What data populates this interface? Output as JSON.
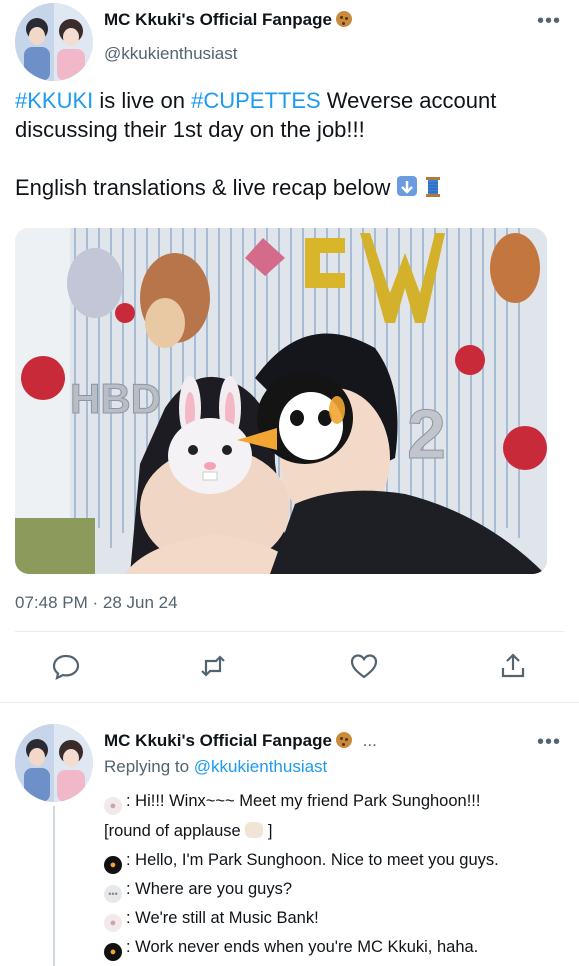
{
  "tweet": {
    "author_name": "MC Kkuki's Official Fanpage",
    "author_handle": "@kkukienthusiast",
    "more_label": "•••",
    "text": {
      "hashtag1": "#KKUKI",
      "part1": " is live on ",
      "hashtag2": "#CUPETTES",
      "part2": " Weverse account discussing their 1st day on the job!!!",
      "line2": "English translations & live recap below"
    },
    "timestamp": "07:48 PM · 28 Jun 24",
    "photo": {
      "balloon_letters": "HBD",
      "balloon_number": "2"
    },
    "icons": {
      "down_arrow": "down-arrow-emoji-icon",
      "spool": "thread-spool-emoji-icon",
      "reply": "reply-icon",
      "retweet": "retweet-icon",
      "like": "heart-icon",
      "share": "share-icon"
    }
  },
  "reply": {
    "author_name": "MC Kkuki's Official Fanpage",
    "ellipsis": "...",
    "more_label": "•••",
    "replying_to_label": "Replying to",
    "replying_to_handle": "@kkukienthusiast",
    "lines": [
      {
        "speaker": "bunny",
        "text": ": Hi!!! Winx~~~ Meet my friend Park Sunghoon!!!"
      },
      {
        "speaker": "none",
        "text": "[round of applause"
      },
      {
        "speaker": "penguin",
        "text": ": Hello, I'm Park Sunghoon. Nice to meet you guys."
      },
      {
        "speaker": "bubble",
        "text": ": Where are you guys?"
      },
      {
        "speaker": "bunny",
        "text": ": We're still at Music Bank!"
      },
      {
        "speaker": "penguin",
        "text": ": Work never ends when you're MC Kkuki, haha."
      }
    ]
  },
  "colors": {
    "accent": "#1d9bf0",
    "text": "#0f1419",
    "muted": "#536471"
  }
}
